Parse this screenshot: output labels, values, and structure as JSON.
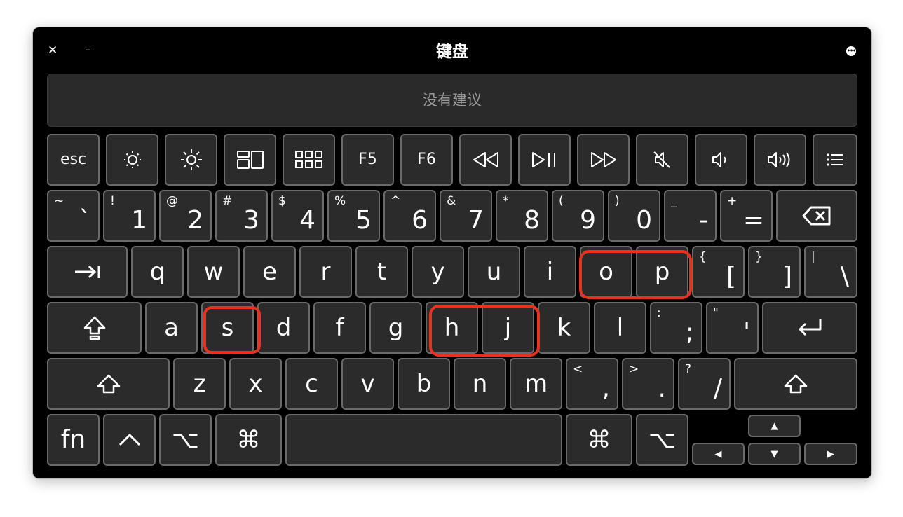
{
  "window": {
    "title": "键盘",
    "close_glyph": "✕",
    "minimize_glyph": "–",
    "menu_icon": "ellipsis-circle-icon"
  },
  "suggestions": {
    "text": "没有建议"
  },
  "keys": {
    "esc": "esc",
    "f5": "F5",
    "f6": "F6",
    "grave": {
      "top": "~",
      "bottom": "`"
    },
    "n1": {
      "top": "!",
      "bottom": "1"
    },
    "n2": {
      "top": "@",
      "bottom": "2"
    },
    "n3": {
      "top": "#",
      "bottom": "3"
    },
    "n4": {
      "top": "$",
      "bottom": "4"
    },
    "n5": {
      "top": "%",
      "bottom": "5"
    },
    "n6": {
      "top": "^",
      "bottom": "6"
    },
    "n7": {
      "top": "&",
      "bottom": "7"
    },
    "n8": {
      "top": "*",
      "bottom": "8"
    },
    "n9": {
      "top": "(",
      "bottom": "9"
    },
    "n0": {
      "top": ")",
      "bottom": "0"
    },
    "minus": {
      "top": "_",
      "bottom": "-"
    },
    "equals": {
      "top": "+",
      "bottom": "="
    },
    "q": "q",
    "w": "w",
    "e": "e",
    "r": "r",
    "t": "t",
    "y": "y",
    "u": "u",
    "i": "i",
    "o": "o",
    "p": "p",
    "lbracket": {
      "top": "{",
      "bottom": "["
    },
    "rbracket": {
      "top": "}",
      "bottom": "]"
    },
    "backslash": {
      "top": "|",
      "bottom": "\\"
    },
    "a": "a",
    "s": "s",
    "d": "d",
    "f": "f",
    "g": "g",
    "h": "h",
    "j": "j",
    "k": "k",
    "l": "l",
    "semicolon": {
      "top": ":",
      "bottom": ";"
    },
    "quote": {
      "top": "\"",
      "bottom": "'"
    },
    "z": "z",
    "x": "x",
    "c": "c",
    "v": "v",
    "b": "b",
    "n": "n",
    "m": "m",
    "comma": {
      "top": "<",
      "bottom": ","
    },
    "period": {
      "top": ">",
      "bottom": "."
    },
    "slash": {
      "top": "?",
      "bottom": "/"
    },
    "fn": "fn",
    "control": "^",
    "option": "⌥",
    "command": "⌘",
    "arrow_up": "▲",
    "arrow_down": "▼",
    "arrow_left": "◀",
    "arrow_right": "▶"
  },
  "highlights": {
    "color": "#e8321f",
    "marked_keys": [
      "o",
      "p",
      "s",
      "h",
      "j"
    ]
  },
  "colors": {
    "window_bg": "#000000",
    "key_bg": "#2b2b2b",
    "key_border": "#6a6a6a",
    "text": "#ffffff"
  }
}
